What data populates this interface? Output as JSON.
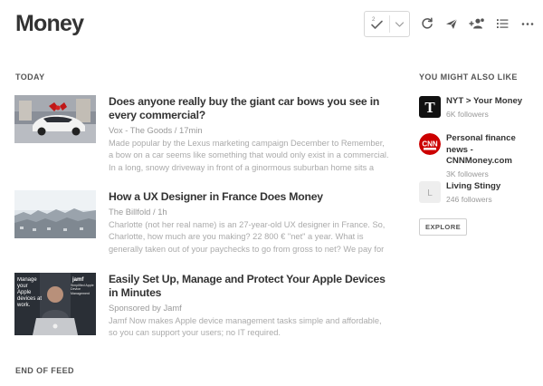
{
  "page": {
    "title": "Money"
  },
  "toolbar": {
    "mark_read_badge": "2",
    "icons": [
      "check-icon",
      "chevron-down-icon",
      "refresh-icon",
      "send-icon",
      "share-people-icon",
      "list-view-icon",
      "more-icon"
    ]
  },
  "feed": {
    "section_label": "TODAY",
    "end_label": "END OF FEED",
    "articles": [
      {
        "title": "Does anyone really buy the giant car bows you see in every commercial?",
        "meta": "Vox - The Goods / 17min",
        "snippet": "Made popular by the Lexus marketing campaign December to Remember, a bow on a car seems like something that would only exist in a commercial. In a long, snowy driveway in front of a ginormous suburban home sits a brand new"
      },
      {
        "title": "How a UX Designer in France Does Money",
        "meta": "The Billfold / 1h",
        "snippet": "Charlotte (not her real name) is an 27-year-old UX designer in France. So, Charlotte, how much are you making? 22 800 € \"net\" a year. What is generally taken out of your paychecks to go from gross to net? We pay for our social"
      },
      {
        "title": "Easily Set Up, Manage and Protect Your Apple Devices in Minutes",
        "meta": "Sponsored by Jamf",
        "snippet": "Jamf Now makes Apple device management tasks simple and affordable, so you can support your users; no IT required.",
        "thumb_text": "Manage your Apple devices at work.",
        "thumb_brand": "jamf",
        "thumb_sub": "Simplified Apple Device Management"
      }
    ]
  },
  "sidebar": {
    "section_label": "YOU MIGHT ALSO LIKE",
    "suggestions": [
      {
        "name": "NYT > Your Money",
        "followers": "6K followers",
        "logo_text": ""
      },
      {
        "name": "Personal finance news - CNNMoney.com",
        "followers": "3K followers",
        "logo_text": "CNN"
      },
      {
        "name": "Living Stingy",
        "followers": "246 followers",
        "logo_text": "L"
      }
    ],
    "explore_label": "EXPLORE"
  },
  "colors": {
    "text": "#333333",
    "muted": "#999999",
    "snippet": "#aaaaaa",
    "cnn_red": "#cc0000"
  }
}
